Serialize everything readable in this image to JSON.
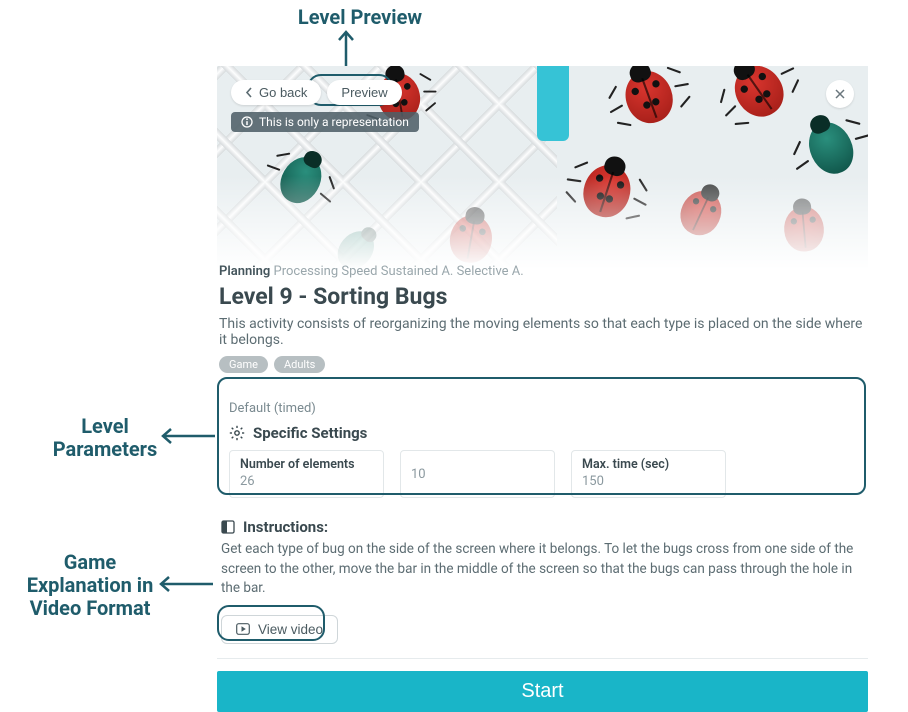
{
  "annotations": {
    "preview": "Level Preview",
    "params_line1": "Level",
    "params_line2": "Parameters",
    "video_line1": "Game",
    "video_line2": "Explanation in",
    "video_line3": "Video Format"
  },
  "topbar": {
    "go_back": "Go back",
    "preview": "Preview",
    "rep_note": "This is only a representation"
  },
  "desc": {
    "skill_primary": "Planning",
    "skill_rest": "Processing Speed Sustained A. Selective A.",
    "title": "Level 9 - Sorting Bugs",
    "subtitle": "This activity consists of reorganizing the moving elements so that each type is placed on the side where it belongs.",
    "tags": [
      "Game",
      "Adults"
    ]
  },
  "settings": {
    "mode": "Default (timed)",
    "subhead": "Specific Settings",
    "fields": {
      "num_elements": {
        "label": "Number of elements",
        "value": "26"
      },
      "middle": {
        "value": "10"
      },
      "max_time": {
        "label": "Max. time (sec)",
        "value": "150"
      }
    }
  },
  "instructions": {
    "heading": "Instructions:",
    "body": "Get each type of bug on the side of the screen where it belongs. To let the bugs cross from one side of the screen to the other, move the bar in the middle of the screen so that the bugs can pass through the hole in the bar.",
    "view_video": "View video"
  },
  "actions": {
    "start": "Start"
  }
}
